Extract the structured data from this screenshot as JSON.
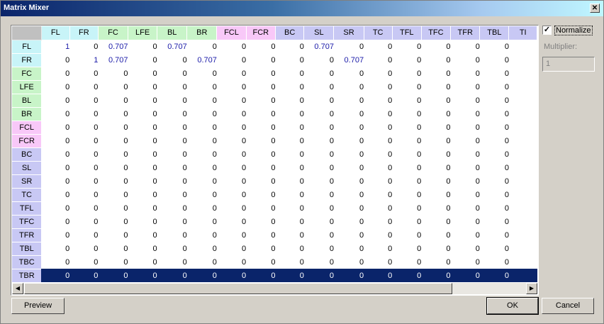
{
  "window": {
    "title": "Matrix Mixer",
    "close_glyph": "✕"
  },
  "columns": [
    {
      "label": "FL",
      "color": "#c8f4f8"
    },
    {
      "label": "FR",
      "color": "#c8f4f8"
    },
    {
      "label": "FC",
      "color": "#c8f4c8"
    },
    {
      "label": "LFE",
      "color": "#c8f4c8"
    },
    {
      "label": "BL",
      "color": "#c8f4c8"
    },
    {
      "label": "BR",
      "color": "#c8f4c8"
    },
    {
      "label": "FCL",
      "color": "#f8c8f8"
    },
    {
      "label": "FCR",
      "color": "#f8c8f8"
    },
    {
      "label": "BC",
      "color": "#c8c8f4"
    },
    {
      "label": "SL",
      "color": "#c8c8f4"
    },
    {
      "label": "SR",
      "color": "#c8c8f4"
    },
    {
      "label": "TC",
      "color": "#c8c8f4"
    },
    {
      "label": "TFL",
      "color": "#c8c8f4"
    },
    {
      "label": "TFC",
      "color": "#c8c8f4"
    },
    {
      "label": "TFR",
      "color": "#c8c8f4"
    },
    {
      "label": "TBL",
      "color": "#c8c8f4"
    }
  ],
  "visible_partial_col_label": "TI",
  "rows": [
    {
      "label": "FL",
      "color": "#c8f4f8",
      "values": [
        "1",
        "0",
        "0.707",
        "0",
        "0.707",
        "0",
        "0",
        "0",
        "0",
        "0.707",
        "0",
        "0",
        "0",
        "0",
        "0",
        "0"
      ]
    },
    {
      "label": "FR",
      "color": "#c8f4f8",
      "values": [
        "0",
        "1",
        "0.707",
        "0",
        "0",
        "0.707",
        "0",
        "0",
        "0",
        "0",
        "0.707",
        "0",
        "0",
        "0",
        "0",
        "0"
      ]
    },
    {
      "label": "FC",
      "color": "#c8f4c8",
      "values": [
        "0",
        "0",
        "0",
        "0",
        "0",
        "0",
        "0",
        "0",
        "0",
        "0",
        "0",
        "0",
        "0",
        "0",
        "0",
        "0"
      ]
    },
    {
      "label": "LFE",
      "color": "#c8f4c8",
      "values": [
        "0",
        "0",
        "0",
        "0",
        "0",
        "0",
        "0",
        "0",
        "0",
        "0",
        "0",
        "0",
        "0",
        "0",
        "0",
        "0"
      ]
    },
    {
      "label": "BL",
      "color": "#c8f4c8",
      "values": [
        "0",
        "0",
        "0",
        "0",
        "0",
        "0",
        "0",
        "0",
        "0",
        "0",
        "0",
        "0",
        "0",
        "0",
        "0",
        "0"
      ]
    },
    {
      "label": "BR",
      "color": "#c8f4c8",
      "values": [
        "0",
        "0",
        "0",
        "0",
        "0",
        "0",
        "0",
        "0",
        "0",
        "0",
        "0",
        "0",
        "0",
        "0",
        "0",
        "0"
      ]
    },
    {
      "label": "FCL",
      "color": "#f8c8f8",
      "values": [
        "0",
        "0",
        "0",
        "0",
        "0",
        "0",
        "0",
        "0",
        "0",
        "0",
        "0",
        "0",
        "0",
        "0",
        "0",
        "0"
      ]
    },
    {
      "label": "FCR",
      "color": "#f8c8f8",
      "values": [
        "0",
        "0",
        "0",
        "0",
        "0",
        "0",
        "0",
        "0",
        "0",
        "0",
        "0",
        "0",
        "0",
        "0",
        "0",
        "0"
      ]
    },
    {
      "label": "BC",
      "color": "#c8c8f4",
      "values": [
        "0",
        "0",
        "0",
        "0",
        "0",
        "0",
        "0",
        "0",
        "0",
        "0",
        "0",
        "0",
        "0",
        "0",
        "0",
        "0"
      ]
    },
    {
      "label": "SL",
      "color": "#c8c8f4",
      "values": [
        "0",
        "0",
        "0",
        "0",
        "0",
        "0",
        "0",
        "0",
        "0",
        "0",
        "0",
        "0",
        "0",
        "0",
        "0",
        "0"
      ]
    },
    {
      "label": "SR",
      "color": "#c8c8f4",
      "values": [
        "0",
        "0",
        "0",
        "0",
        "0",
        "0",
        "0",
        "0",
        "0",
        "0",
        "0",
        "0",
        "0",
        "0",
        "0",
        "0"
      ]
    },
    {
      "label": "TC",
      "color": "#c8c8f4",
      "values": [
        "0",
        "0",
        "0",
        "0",
        "0",
        "0",
        "0",
        "0",
        "0",
        "0",
        "0",
        "0",
        "0",
        "0",
        "0",
        "0"
      ]
    },
    {
      "label": "TFL",
      "color": "#c8c8f4",
      "values": [
        "0",
        "0",
        "0",
        "0",
        "0",
        "0",
        "0",
        "0",
        "0",
        "0",
        "0",
        "0",
        "0",
        "0",
        "0",
        "0"
      ]
    },
    {
      "label": "TFC",
      "color": "#c8c8f4",
      "values": [
        "0",
        "0",
        "0",
        "0",
        "0",
        "0",
        "0",
        "0",
        "0",
        "0",
        "0",
        "0",
        "0",
        "0",
        "0",
        "0"
      ]
    },
    {
      "label": "TFR",
      "color": "#c8c8f4",
      "values": [
        "0",
        "0",
        "0",
        "0",
        "0",
        "0",
        "0",
        "0",
        "0",
        "0",
        "0",
        "0",
        "0",
        "0",
        "0",
        "0"
      ]
    },
    {
      "label": "TBL",
      "color": "#c8c8f4",
      "values": [
        "0",
        "0",
        "0",
        "0",
        "0",
        "0",
        "0",
        "0",
        "0",
        "0",
        "0",
        "0",
        "0",
        "0",
        "0",
        "0"
      ]
    },
    {
      "label": "TBC",
      "color": "#c8c8f4",
      "values": [
        "0",
        "0",
        "0",
        "0",
        "0",
        "0",
        "0",
        "0",
        "0",
        "0",
        "0",
        "0",
        "0",
        "0",
        "0",
        "0"
      ]
    },
    {
      "label": "TBR",
      "color": "#c8c8f4",
      "values": [
        "0",
        "0",
        "0",
        "0",
        "0",
        "0",
        "0",
        "0",
        "0",
        "0",
        "0",
        "0",
        "0",
        "0",
        "0",
        "0"
      ],
      "selected": true
    }
  ],
  "scrollbar": {
    "left_glyph": "◀",
    "right_glyph": "▶"
  },
  "options": {
    "normalize_label": "Normalize",
    "normalize_checked": true,
    "check_glyph": "✓",
    "multiplier_label": "Multiplier:",
    "multiplier_value": "1"
  },
  "buttons": {
    "preview": "Preview",
    "ok": "OK",
    "cancel": "Cancel"
  }
}
